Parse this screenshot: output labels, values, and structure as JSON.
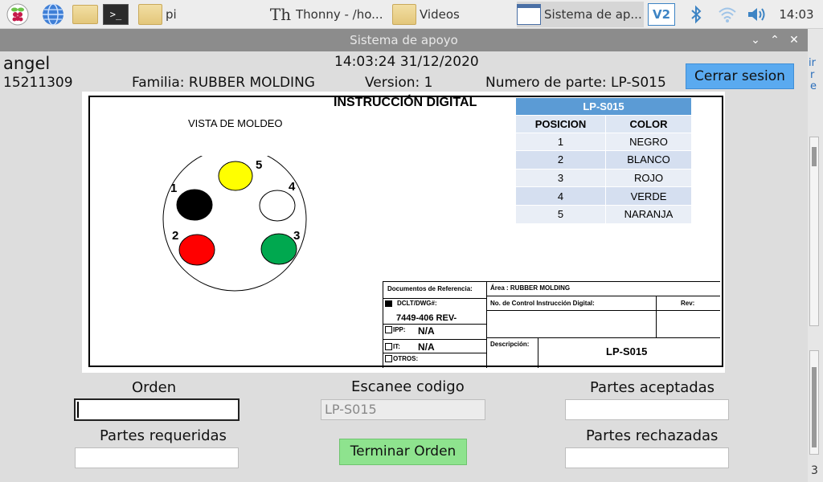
{
  "taskbar": {
    "tasks": [
      {
        "label": "pi"
      },
      {
        "label": "Thonny  -  /ho..."
      },
      {
        "label": "Videos"
      },
      {
        "label": "Sistema de ap..."
      }
    ],
    "clock": "14:03"
  },
  "window": {
    "title": "Sistema de apoyo",
    "buttons": {
      "minimize": "⌄",
      "maximize": "⌃",
      "close": "✕"
    }
  },
  "header": {
    "user": "angel",
    "employee_id": "15211309",
    "datetime": "14:03:24 31/12/2020",
    "family": "Familia: RUBBER MOLDING",
    "version": "Version: 1",
    "part_number": "Numero de parte: LP-S015",
    "logout_label": "Cerrar sesion"
  },
  "instruction": {
    "title": "INSTRUCCIÓN DIGITAL",
    "view_label": "VISTA DE MOLDEO",
    "cavities": [
      {
        "num": "1",
        "color": "#000000"
      },
      {
        "num": "2",
        "color": "#ff0000"
      },
      {
        "num": "3",
        "color": "#00a84f"
      },
      {
        "num": "4",
        "color": "#ffffff"
      },
      {
        "num": "5",
        "color": "#ffff00"
      }
    ],
    "table": {
      "title": "LP-S015",
      "headers": [
        "POSICION",
        "COLOR"
      ],
      "rows": [
        [
          "1",
          "NEGRO"
        ],
        [
          "2",
          "BLANCO"
        ],
        [
          "3",
          "ROJO"
        ],
        [
          "4",
          "VERDE"
        ],
        [
          "5",
          "NARANJA"
        ]
      ]
    },
    "refs": {
      "docs_label": "Documentos de Referencia:",
      "area_label": "Área : RUBBER MOLDING",
      "dclt_label": "DCLT/DWG#:",
      "dclt_value": "7449-406 REV-",
      "control_label": "No. de Control Instrucción Digital:",
      "rev_label": "Rev:",
      "ipp_label": "IPP:",
      "ipp_value": "N/A",
      "it_label": "IT:",
      "it_value": "N/A",
      "otros_label": "OTROS:",
      "desc_label": "Descripción:",
      "desc_value": "LP-S015"
    }
  },
  "form": {
    "orden_label": "Orden",
    "orden_value": "",
    "escanee_label": "Escanee codigo",
    "escanee_value": "LP-S015",
    "aceptadas_label": "Partes aceptadas",
    "aceptadas_value": "",
    "requeridas_label": "Partes requeridas",
    "requeridas_value": "",
    "rechazadas_label": "Partes rechazadas",
    "rechazadas_value": "",
    "terminar_label": "Terminar Orden"
  },
  "behind_window": {
    "right_letters": [
      "ir",
      "r",
      "e"
    ],
    "bottom_digit": "3"
  }
}
